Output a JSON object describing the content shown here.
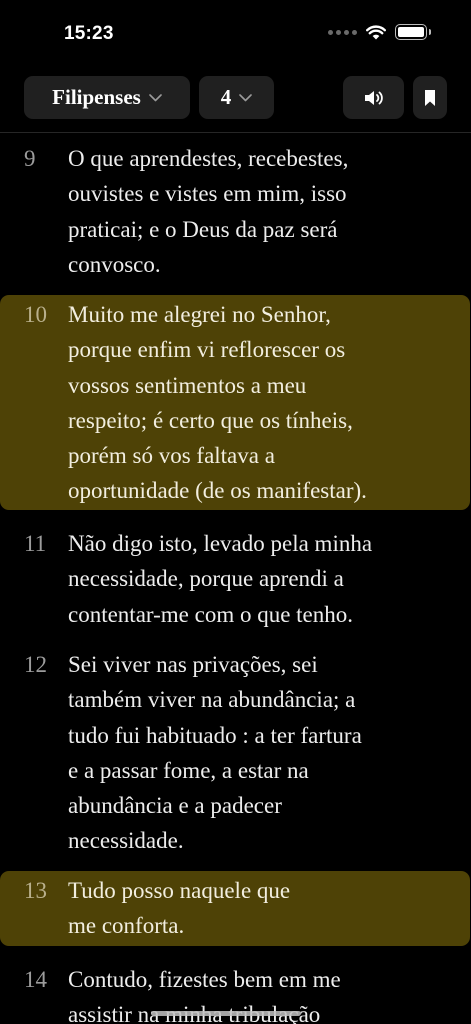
{
  "status": {
    "time": "15:23",
    "battery_level": 1.0
  },
  "toolbar": {
    "book": "Filipenses",
    "chapter": "4",
    "chevron_icon": "chevron-down-icon",
    "audio_icon": "speaker-icon",
    "bookmark_icon": "bookmark-icon"
  },
  "colors": {
    "background": "#000000",
    "pill": "#202020",
    "highlight": "#4e4206"
  },
  "verses": [
    {
      "num": "9",
      "text": "O que aprendestes, recebestes,\nouvistes e vistes em mim, isso\npraticai; e o Deus da paz será\nconvosco.",
      "highlighted": false
    },
    {
      "num": "10",
      "text": "Muito me alegrei no Senhor,\nporque enfim vi reflorescer os\nvossos sentimentos a meu\nrespeito; é certo que os tínheis,\nporém só vos faltava a\noportunidade (de os manifestar).",
      "highlighted": true
    },
    {
      "num": "11",
      "text": "Não digo isto, levado pela minha\nnecessidade, porque aprendi a\ncontentar-me com o que tenho.",
      "highlighted": false
    },
    {
      "num": "12",
      "text": "Sei viver nas privações, sei\ntambém viver na abundância; a\ntudo fui habituado : a ter fartura\ne a passar fome, a estar na\nabundância e a padecer\nnecessidade.",
      "highlighted": false
    },
    {
      "num": "13",
      "text": "Tudo posso naquele que\nme conforta.",
      "highlighted": true
    },
    {
      "num": "14",
      "text": "Contudo, fizestes bem em me\nassistir na minha tribulação",
      "highlighted": false
    }
  ]
}
